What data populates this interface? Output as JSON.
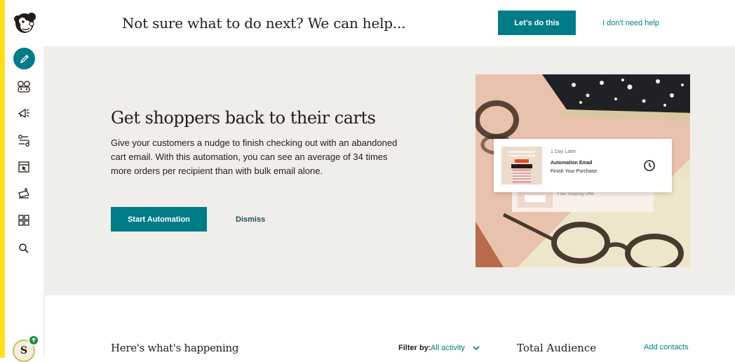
{
  "colors": {
    "accent": "#007c89",
    "sidebar_strip": "#ffe01b",
    "hero_bg": "#efeeea",
    "badge": "#0e8a3e"
  },
  "sidebar": {
    "items": [
      {
        "icon": "pencil-icon",
        "active": true
      },
      {
        "icon": "audience-icon"
      },
      {
        "icon": "megaphone-icon"
      },
      {
        "icon": "automations-icon"
      },
      {
        "icon": "website-icon"
      },
      {
        "icon": "content-studio-icon"
      },
      {
        "icon": "integrations-grid-icon"
      },
      {
        "icon": "search-icon"
      }
    ],
    "avatar_initial": "S"
  },
  "topbar": {
    "prompt": "Not sure what to do next? We can help...",
    "primary_button": "Let's do this",
    "secondary_link": "I don't need help"
  },
  "hero": {
    "title": "Get shoppers back to their carts",
    "description": "Give your customers a nudge to finish checking out with an abandoned cart email. With this automation, you can see an average of 34 times more orders per recipient than with bulk email alone.",
    "primary_button": "Start Automation",
    "dismiss_link": "Dismiss",
    "card": {
      "delay": "1 Day Later",
      "title": "Automation Email",
      "subtitle": "Finish Your Purchase",
      "secondary_text": "Free Shipping Offer"
    }
  },
  "activity": {
    "title": "Here's what's happening",
    "filter_label": "Filter by:",
    "filter_value": "All activity"
  },
  "audience": {
    "title": "Total Audience",
    "add_link": "Add contacts"
  }
}
